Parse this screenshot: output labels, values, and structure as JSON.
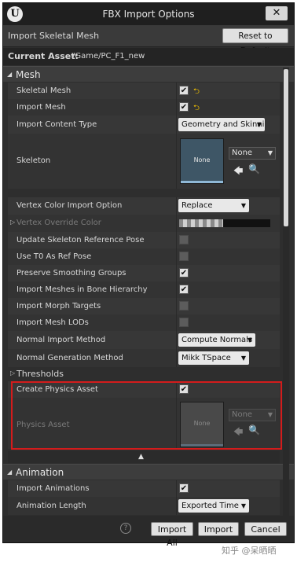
{
  "window": {
    "title": "FBX Import Options",
    "close_label": "✕",
    "logo_text": "U"
  },
  "header": {
    "import_label": "Import Skeletal Mesh",
    "reset_label": "Reset to Default"
  },
  "current_asset": {
    "label": "Current Asset:",
    "value": "/Game/PC_F1_new"
  },
  "sections": {
    "mesh": "Mesh",
    "animation": "Animation"
  },
  "mesh": {
    "skeletal_mesh": {
      "label": "Skeletal Mesh",
      "checked": true
    },
    "import_mesh": {
      "label": "Import Mesh",
      "checked": true
    },
    "import_content_type": {
      "label": "Import Content Type",
      "value": "Geometry and Skinni"
    },
    "skeleton": {
      "label": "Skeleton",
      "thumb_text": "None",
      "combo_value": "None"
    },
    "vertex_color_import_option": {
      "label": "Vertex Color Import Option",
      "value": "Replace"
    },
    "vertex_override_color": {
      "label": "Vertex Override Color"
    },
    "update_skeleton_reference_pose": {
      "label": "Update Skeleton Reference Pose",
      "checked": false
    },
    "use_t0_as_ref_pose": {
      "label": "Use T0 As Ref Pose",
      "checked": false
    },
    "preserve_smoothing_groups": {
      "label": "Preserve Smoothing Groups",
      "checked": true
    },
    "import_meshes_in_bone_hierarchy": {
      "label": "Import Meshes in Bone Hierarchy",
      "checked": true
    },
    "import_morph_targets": {
      "label": "Import Morph Targets",
      "checked": false
    },
    "import_mesh_lods": {
      "label": "Import Mesh LODs",
      "checked": false
    },
    "normal_import_method": {
      "label": "Normal Import Method",
      "value": "Compute Normals"
    },
    "normal_generation_method": {
      "label": "Normal Generation Method",
      "value": "Mikk TSpace"
    },
    "thresholds": {
      "label": "Thresholds"
    },
    "create_physics_asset": {
      "label": "Create Physics Asset",
      "checked": true
    },
    "physics_asset": {
      "label": "Physics Asset",
      "thumb_text": "None",
      "combo_value": "None"
    }
  },
  "animation": {
    "import_animations": {
      "label": "Import Animations",
      "checked": true
    },
    "animation_length": {
      "label": "Animation Length",
      "value": "Exported Time"
    }
  },
  "footer": {
    "help": "?",
    "import_all": "Import All",
    "import": "Import",
    "cancel": "Cancel"
  },
  "glyphs": {
    "check": "✔",
    "reset": "⮌",
    "caret": "▼",
    "collapse": "▲",
    "expand_right": "▷",
    "expand_down": "◢",
    "use_selected": "🡄",
    "browse": "🔍"
  },
  "colors": {
    "highlight_border": "#d31c1c",
    "reset_arrow": "#f0c000"
  },
  "watermark": "知乎 @呆晒晒"
}
